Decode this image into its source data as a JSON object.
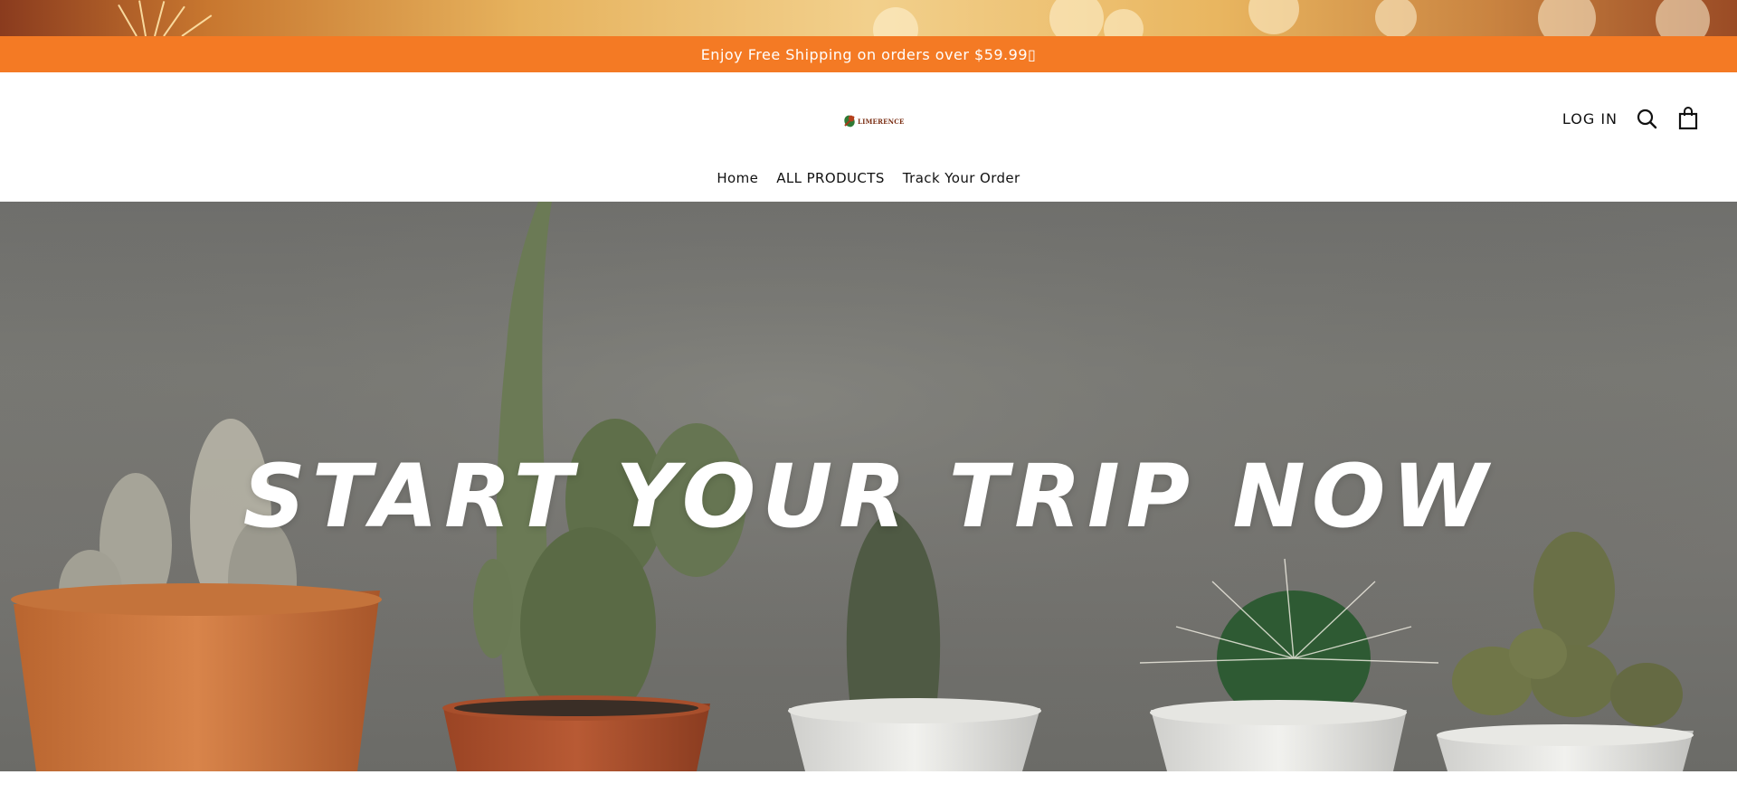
{
  "announcement": {
    "text": "Enjoy Free Shipping on orders over $59.99▯"
  },
  "brand": {
    "logo_text": "LIMERENCE"
  },
  "header": {
    "login_label": "LOG IN"
  },
  "icons": {
    "search": "search-icon",
    "cart": "shopping-bag-icon",
    "logo": "leaf-logo-icon"
  },
  "nav": {
    "items": [
      {
        "label": "Home"
      },
      {
        "label": "ALL PRODUCTS"
      },
      {
        "label": "Track Your Order"
      }
    ]
  },
  "hero": {
    "title": "START YOUR TRIP NOW"
  },
  "colors": {
    "announcement_bg": "#f47a24",
    "hero_title": "#ffffff"
  }
}
